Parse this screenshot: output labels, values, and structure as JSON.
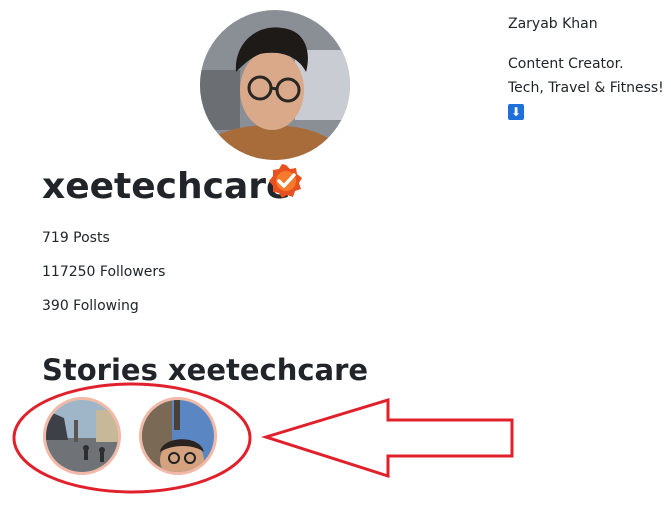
{
  "profile": {
    "username": "xeetechcare",
    "verified": true,
    "avatar_icon": "profile-photo"
  },
  "bio": {
    "name": "Zaryab Khan",
    "line1": "Content Creator.",
    "line2": "Tech, Travel & Fitness!",
    "arrow_emoji": "⬇"
  },
  "stats": {
    "posts": "719 Posts",
    "followers": "117250 Followers",
    "following": "390 Following"
  },
  "stories": {
    "title": "Stories xeetechcare",
    "items": [
      {
        "icon": "street-scene-thumbnail"
      },
      {
        "icon": "selfie-thumbnail"
      }
    ]
  },
  "colors": {
    "story_ring": "#f2b9a6",
    "annotation_red": "#e0202a",
    "verified_badge": "#e8501f"
  }
}
